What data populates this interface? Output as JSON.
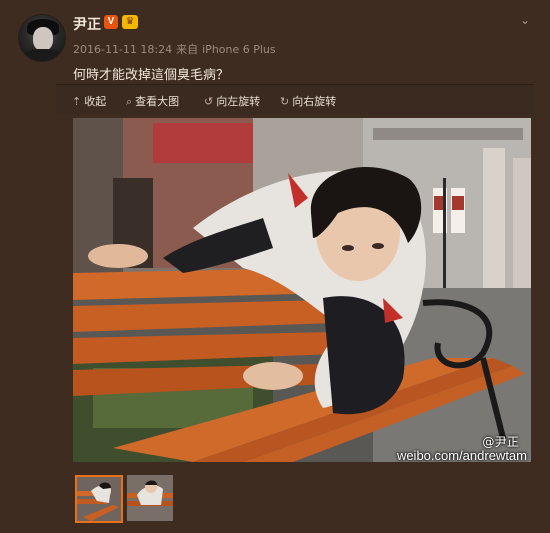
{
  "post": {
    "author_name": "尹正",
    "verified_badge": "V",
    "vip_badge": "♛",
    "timestamp": "2016-11-11 18:24",
    "source_prefix": "来自",
    "source_device": "iPhone 6 Plus",
    "text": "何時才能改掉這個臭毛病？",
    "menu_icon": "chevron-down-icon"
  },
  "actions": [
    {
      "icon": "collapse-icon",
      "glyph": "⇡",
      "label": "收起"
    },
    {
      "icon": "search-icon",
      "glyph": "⌕",
      "label": "查看大图"
    },
    {
      "icon": "rotate-left-icon",
      "glyph": "↺",
      "label": "向左旋转"
    },
    {
      "icon": "rotate-right-icon",
      "glyph": "↻",
      "label": "向右旋转"
    }
  ],
  "photo": {
    "watermark_handle": "@尹正",
    "watermark_url": "weibo.com/andrewtam"
  },
  "thumbnails": [
    {
      "selected": true
    },
    {
      "selected": false
    }
  ],
  "colors": {
    "background": "#3e2c21",
    "accent": "#e8711b",
    "verified": "#e8530e",
    "vip": "#f5b800"
  }
}
